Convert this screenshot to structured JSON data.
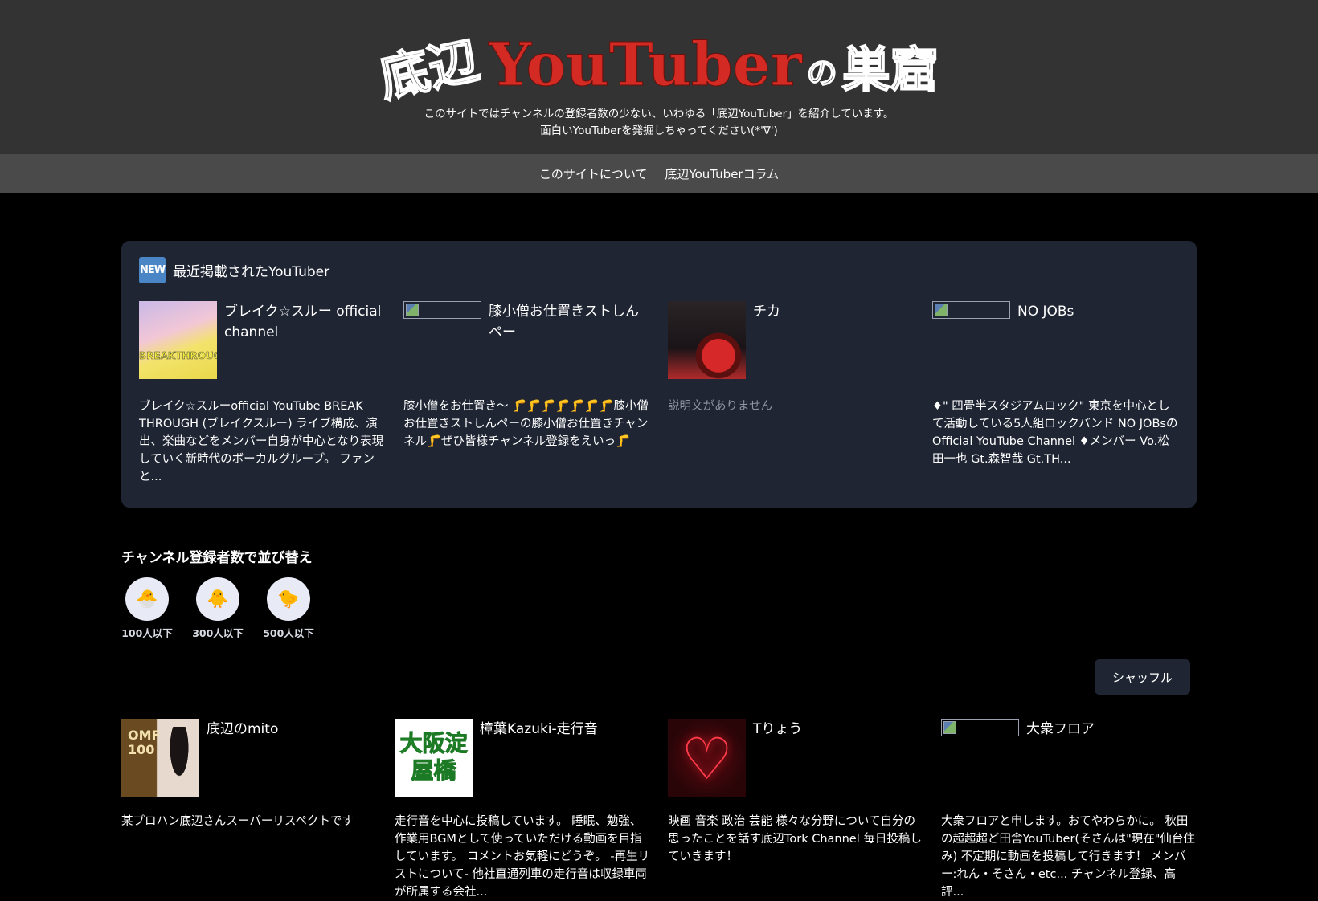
{
  "header": {
    "logo_part1": "底辺",
    "logo_part2": "YouTuber",
    "logo_part3": "の",
    "logo_part4": "巣窟",
    "tagline_line1": "このサイトではチャンネルの登録者数の少ない、いわゆる「底辺YouTuber」を紹介しています。",
    "tagline_line2": "面白いYouTuberを発掘しちゃってください(*'∇')"
  },
  "nav": {
    "items": [
      {
        "label": "このサイトについて"
      },
      {
        "label": "底辺YouTuberコラム"
      }
    ]
  },
  "recent": {
    "badge": "NEW",
    "title": "最近掲載されたYouTuber",
    "cards": [
      {
        "name": "ブレイク☆スルー official channel",
        "thumb": "break",
        "description": "ブレイク☆スルーofficial YouTube BREAK THROUGH (ブレイクスルー) ライブ構成、演出、楽曲などをメンバー自身が中心となり表現していく新時代のボーカルグループ。 ファンと..."
      },
      {
        "name": "膝小僧お仕置きストしんペー",
        "thumb": "broken",
        "description": "膝小僧をお仕置き〜 🦵🦵🦵🦵🦵🦵🦵膝小僧お仕置きストしんペーの膝小僧お仕置きチャンネル🦵ぜひ皆様チャンネル登録をえいっ🦵"
      },
      {
        "name": "チカ",
        "thumb": "chika",
        "description": "説明文がありません"
      },
      {
        "name": "NO JOBs",
        "thumb": "broken",
        "description": "♦\" 四畳半スタジアムロック\" 東京を中心として活動している5人組ロックバンド NO JOBsのOfficial YouTube Channel ♦メンバー Vo.松田一也 Gt.森智哉 Gt.TH..."
      }
    ]
  },
  "sort": {
    "title": "チャンネル登録者数で並び替え",
    "options": [
      {
        "icon": "🐣",
        "label": "100人以下"
      },
      {
        "icon": "🐥",
        "label": "300人以下"
      },
      {
        "icon": "🐤",
        "label": "500人以下"
      }
    ]
  },
  "shuffle_label": "シャッフル",
  "list": {
    "cards": [
      {
        "name": "底辺のmito",
        "thumb": "mito",
        "description": "某プロハン底辺さんスーパーリスペクトです"
      },
      {
        "name": "樟葉Kazuki-走行音",
        "thumb": "osaka",
        "thumb_text": "大阪淀屋橋",
        "description": "走行音を中心に投稿しています。 睡眠、勉強、作業用BGMとして使っていただける動画を目指しています。 コメントお気軽にどうぞ。 -再生リストについて- 他社直通列車の走行音は収録車両が所属する会社..."
      },
      {
        "name": "Tりょう",
        "thumb": "heart",
        "description": "映画 音楽 政治 芸能 様々な分野について自分の思ったことを話す底辺Tork Channel 毎日投稿していきます！"
      },
      {
        "name": "大衆フロア",
        "thumb": "broken",
        "description": "大衆フロアと申します。おてやわらかに。 秋田の超超超ど田舎YouTuber(そさんは\"現在\"仙台住み) 不定期に動画を投稿して行きます！ メンバー:れん・そさん・etc... チャンネル登録、高評..."
      }
    ]
  },
  "colors": {
    "header_bg": "#333333",
    "nav_bg": "#4a4a4a",
    "panel_bg": "#1f2533",
    "logo_red": "#d32b24",
    "badge_blue": "#4a86c5"
  }
}
